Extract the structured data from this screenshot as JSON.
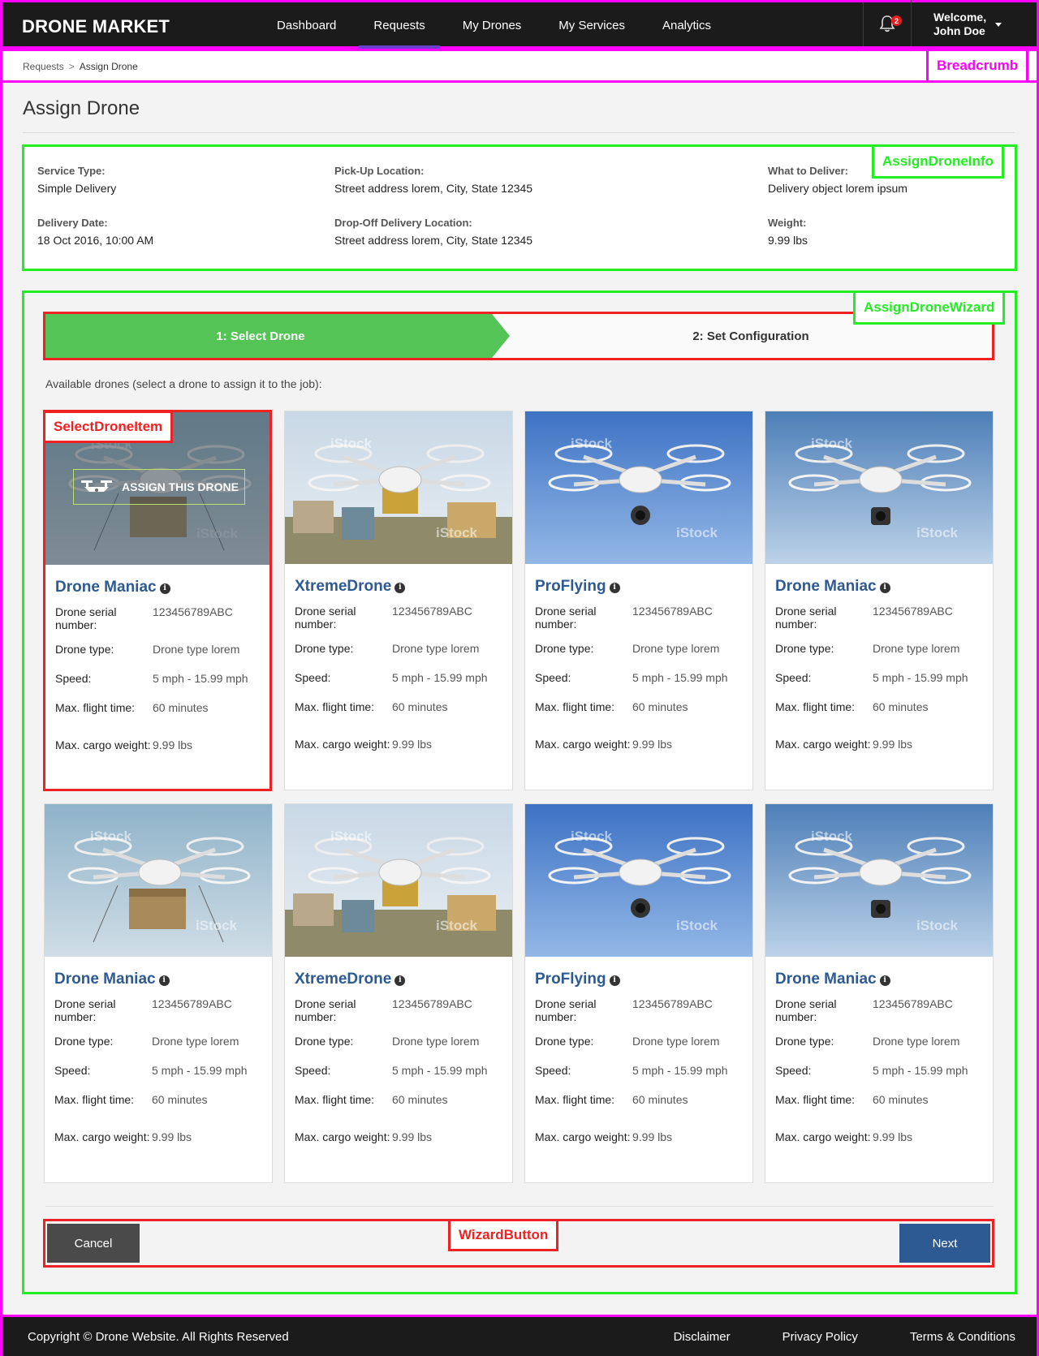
{
  "header": {
    "brand": "DRONE MARKET",
    "nav": [
      "Dashboard",
      "Requests",
      "My Drones",
      "My Services",
      "Analytics"
    ],
    "active_nav": "Requests",
    "notification_count": "2",
    "user_line1": "Welcome,",
    "user_line2": "John Doe"
  },
  "breadcrumb": {
    "items": [
      "Requests",
      "Assign Drone"
    ],
    "separator": ">"
  },
  "annotations": {
    "breadcrumb": "Breadcrumb",
    "info": "AssignDroneInfo",
    "wizard": "AssignDroneWizard",
    "item": "SelectDroneItem",
    "buttons": "WizardButton"
  },
  "page": {
    "title": "Assign Drone"
  },
  "info": {
    "service_type_label": "Service Type:",
    "service_type": "Simple Delivery",
    "delivery_date_label": "Delivery Date:",
    "delivery_date": "18 Oct 2016, 10:00 AM",
    "pickup_label": "Pick-Up Location:",
    "pickup": "Street address lorem, City, State 12345",
    "dropoff_label": "Drop-Off Delivery Location:",
    "dropoff": "Street address lorem, City, State 12345",
    "deliver_label": "What to Deliver:",
    "deliver": "Delivery object lorem ipsum",
    "weight_label": "Weight:",
    "weight": "9.99 lbs"
  },
  "wizard": {
    "step1": "1: Select Drone",
    "step2": "2: Set Configuration",
    "available_text": "Available drones (select a drone to assign it to the job):",
    "assign_label": "ASSIGN THIS DRONE",
    "spec_labels": {
      "serial": "Drone serial number:",
      "type": "Drone type:",
      "speed": "Speed:",
      "flight": "Max. flight time:",
      "cargo": "Max. cargo weight:"
    },
    "drones": [
      {
        "name": "Drone Maniac",
        "serial": "123456789ABC",
        "type": "Drone type lorem",
        "speed": "5 mph - 15.99 mph",
        "flight": "60 minutes",
        "cargo": "9.99 lbs",
        "image": "delivery-drone-box"
      },
      {
        "name": "XtremeDrone",
        "serial": "123456789ABC",
        "type": "Drone type lorem",
        "speed": "5 mph - 15.99 mph",
        "flight": "60 minutes",
        "cargo": "9.99 lbs",
        "image": "drone-houses"
      },
      {
        "name": "ProFlying",
        "serial": "123456789ABC",
        "type": "Drone type lorem",
        "speed": "5 mph - 15.99 mph",
        "flight": "60 minutes",
        "cargo": "9.99 lbs",
        "image": "drone-blue-sky"
      },
      {
        "name": "Drone Maniac",
        "serial": "123456789ABC",
        "type": "Drone type lorem",
        "speed": "5 mph - 15.99 mph",
        "flight": "60 minutes",
        "cargo": "9.99 lbs",
        "image": "drone-camera"
      },
      {
        "name": "Drone Maniac",
        "serial": "123456789ABC",
        "type": "Drone type lorem",
        "speed": "5 mph - 15.99 mph",
        "flight": "60 minutes",
        "cargo": "9.99 lbs",
        "image": "delivery-drone-box"
      },
      {
        "name": "XtremeDrone",
        "serial": "123456789ABC",
        "type": "Drone type lorem",
        "speed": "5 mph - 15.99 mph",
        "flight": "60 minutes",
        "cargo": "9.99 lbs",
        "image": "drone-houses"
      },
      {
        "name": "ProFlying",
        "serial": "123456789ABC",
        "type": "Drone type lorem",
        "speed": "5 mph - 15.99 mph",
        "flight": "60 minutes",
        "cargo": "9.99 lbs",
        "image": "drone-blue-sky"
      },
      {
        "name": "Drone Maniac",
        "serial": "123456789ABC",
        "type": "Drone type lorem",
        "speed": "5 mph - 15.99 mph",
        "flight": "60 minutes",
        "cargo": "9.99 lbs",
        "image": "drone-camera"
      }
    ],
    "watermark": "iStock",
    "cancel": "Cancel",
    "next": "Next"
  },
  "footer": {
    "copyright": "Copyright © Drone Website. All Rights Reserved",
    "links": [
      "Disclaimer",
      "Privacy Policy",
      "Terms & Conditions"
    ]
  },
  "colors": {
    "header_bg": "#1b1b1b",
    "step_active": "#55c456",
    "drone_name": "#2d5a92",
    "next_button": "#2e5a93",
    "cancel_button": "#4a4a4a"
  }
}
